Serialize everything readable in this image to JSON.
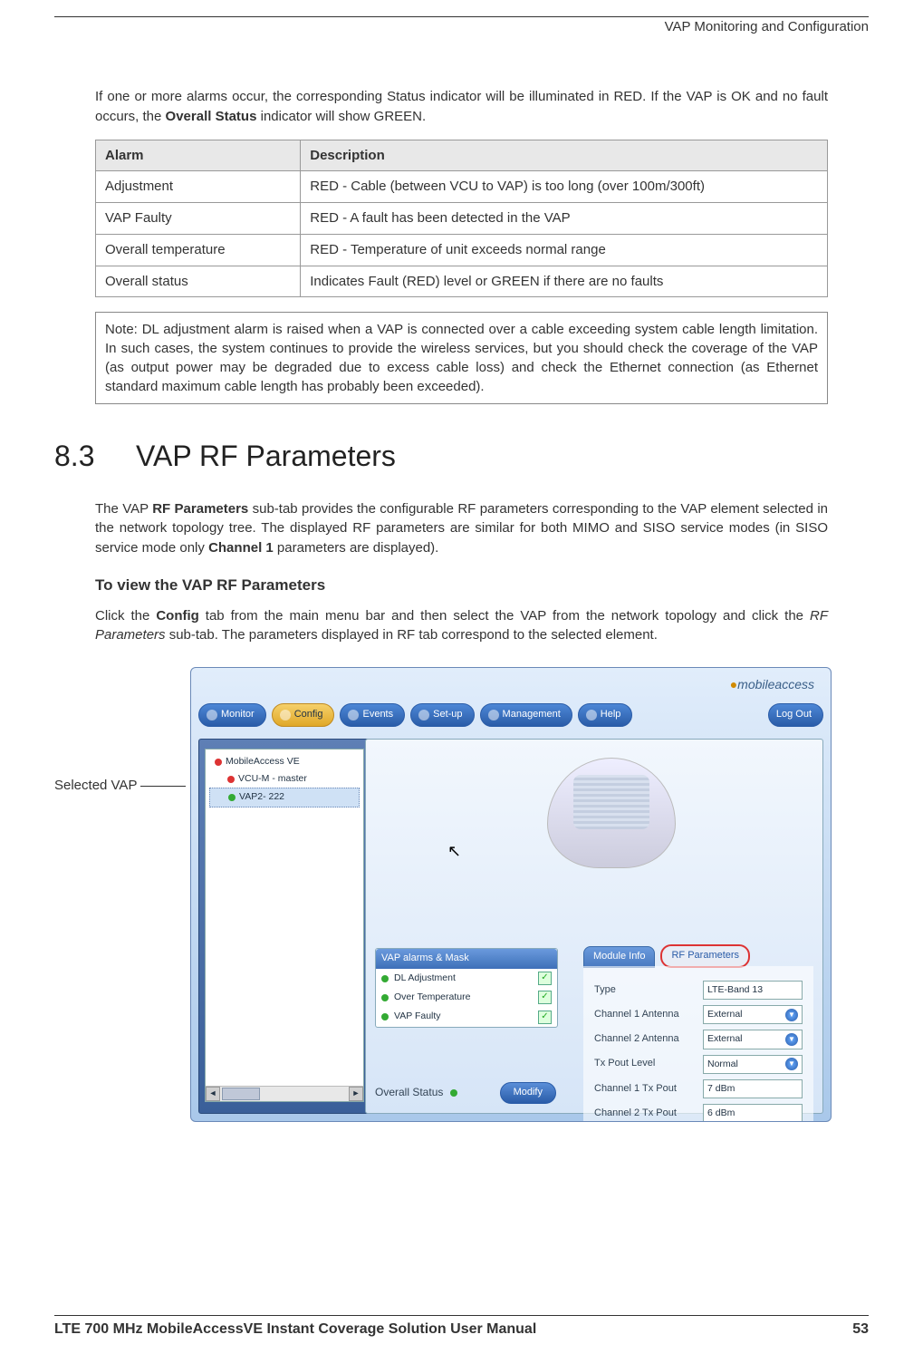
{
  "header": {
    "chapter_title": "VAP Monitoring and Configuration"
  },
  "intro_p1_a": "If one or more alarms occur, the corresponding Status indicator will be illuminated in RED. If the VAP is OK and no fault occurs, the ",
  "intro_p1_b": "Overall Status",
  "intro_p1_c": " indicator will show GREEN.",
  "table": {
    "head": {
      "c1": "Alarm",
      "c2": "Description"
    },
    "rows": [
      {
        "c1": "Adjustment",
        "c2": "RED - Cable (between VCU to VAP) is too long (over 100m/300ft)"
      },
      {
        "c1": "VAP Faulty",
        "c2": "RED - A fault has been detected in the VAP"
      },
      {
        "c1": "Overall temperature",
        "c2": "RED - Temperature of unit exceeds normal range"
      },
      {
        "c1": "Overall status",
        "c2": "Indicates Fault (RED) level or GREEN if there are no faults"
      }
    ]
  },
  "note": "Note: DL adjustment alarm is raised when a VAP is connected over a cable exceeding system cable length limitation. In such cases, the system continues to provide the wireless services, but you should check the coverage of the VAP (as output power may be degraded due to excess cable loss) and check the Ethernet connection (as Ethernet standard maximum cable length has probably been exceeded).",
  "section": {
    "num": "8.3",
    "title": "VAP RF Parameters"
  },
  "p2_a": "The VAP ",
  "p2_b": "RF Parameters",
  "p2_c": " sub-tab provides the configurable RF parameters corresponding to the VAP element selected in the network topology tree. The displayed RF parameters are similar for both MIMO and SISO service modes (in SISO service mode only ",
  "p2_d": "Channel 1",
  "p2_e": " parameters are displayed).",
  "h3": "To view the VAP RF Parameters",
  "p3_a": "Click the ",
  "p3_b": "Config",
  "p3_c": " tab from the main menu bar and then select the VAP from the network topology and click the ",
  "p3_d": "RF Parameters",
  "p3_e": " sub-tab. The parameters displayed in RF tab correspond to the selected element.",
  "callout": "Selected VAP",
  "app": {
    "logo": "mobileaccess",
    "menu": [
      "Monitor",
      "Config",
      "Events",
      "Set-up",
      "Management",
      "Help"
    ],
    "logout": "Log Out",
    "tree": {
      "root": "MobileAccess VE",
      "node1": "VCU-M - master",
      "node2": "VAP2- 222"
    },
    "alarms": {
      "title": "VAP alarms & Mask",
      "items": [
        "DL Adjustment",
        "Over Temperature",
        "VAP Faulty"
      ]
    },
    "overall_status": "Overall Status",
    "modify": "Modify",
    "tabs": {
      "info": "Module Info",
      "rf": "RF Parameters"
    },
    "rf": [
      {
        "label": "Type",
        "value": "LTE-Band 13",
        "dd": false
      },
      {
        "label": "Channel 1 Antenna",
        "value": "External",
        "dd": true
      },
      {
        "label": "Channel 2 Antenna",
        "value": "External",
        "dd": true
      },
      {
        "label": "Tx Pout Level",
        "value": "Normal",
        "dd": true
      },
      {
        "label": "Channel 1 Tx Pout",
        "value": "7 dBm",
        "dd": false
      },
      {
        "label": "Channel 2 Tx Pout",
        "value": "6 dBm",
        "dd": false
      }
    ]
  },
  "footer": {
    "title": "LTE 700 MHz MobileAccessVE Instant Coverage Solution User Manual",
    "page": "53"
  }
}
